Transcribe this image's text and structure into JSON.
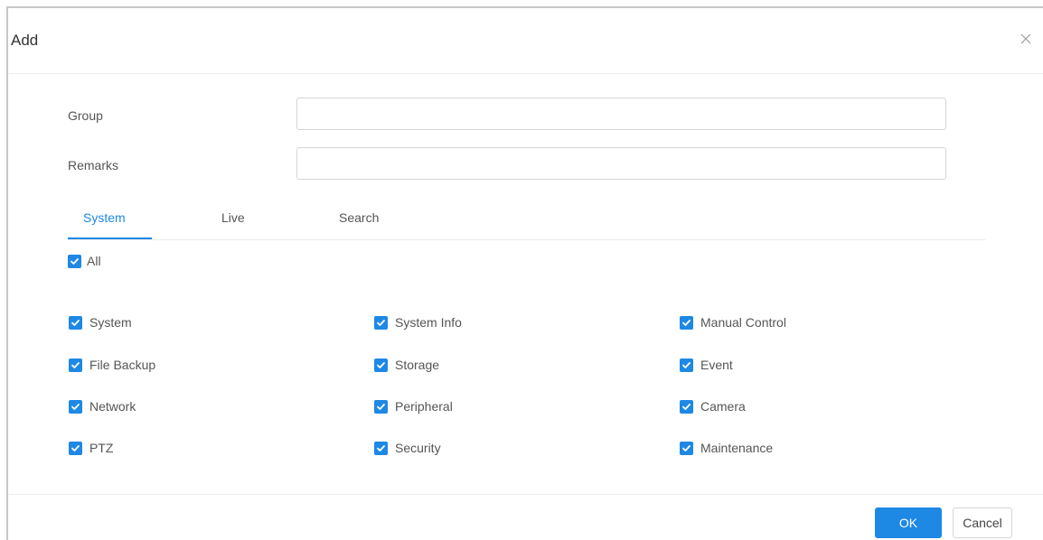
{
  "dialog": {
    "title": "Add",
    "close_icon": "close-icon"
  },
  "form": {
    "group": {
      "label": "Group",
      "value": "",
      "placeholder": ""
    },
    "remarks": {
      "label": "Remarks",
      "value": "",
      "placeholder": ""
    }
  },
  "tabs": [
    {
      "label": "System",
      "active": true
    },
    {
      "label": "Live",
      "active": false
    },
    {
      "label": "Search",
      "active": false
    }
  ],
  "permissions": {
    "all": {
      "label": "All",
      "checked": true
    },
    "items": [
      {
        "label": "System",
        "checked": true
      },
      {
        "label": "System Info",
        "checked": true
      },
      {
        "label": "Manual Control",
        "checked": true
      },
      {
        "label": "File Backup",
        "checked": true
      },
      {
        "label": "Storage",
        "checked": true
      },
      {
        "label": "Event",
        "checked": true
      },
      {
        "label": "Network",
        "checked": true
      },
      {
        "label": "Peripheral",
        "checked": true
      },
      {
        "label": "Camera",
        "checked": true
      },
      {
        "label": "PTZ",
        "checked": true
      },
      {
        "label": "Security",
        "checked": true
      },
      {
        "label": "Maintenance",
        "checked": true
      }
    ]
  },
  "footer": {
    "ok_label": "OK",
    "cancel_label": "Cancel"
  },
  "colors": {
    "accent": "#1e88e5",
    "text": "#555555",
    "border": "#d6d6d6"
  }
}
